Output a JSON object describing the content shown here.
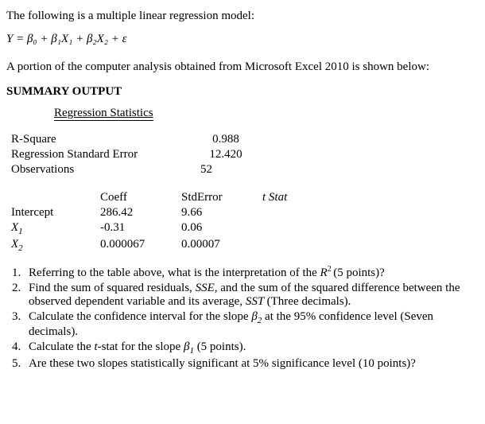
{
  "intro": "The following is a multiple linear regression model:",
  "equation": "Y = β₀ + β₁X₁ + β₂X₂ + ε",
  "context": "A portion of the computer analysis obtained from Microsoft Excel 2010 is shown below:",
  "summary_title": "SUMMARY OUTPUT",
  "reg_stats_header": "Regression Statistics",
  "stats": {
    "r_square_label": "R-Square",
    "r_square_value": "0.988",
    "rse_label": "Regression Standard Error",
    "rse_value": "12.420",
    "obs_label": "Observations",
    "obs_value": "52"
  },
  "coef_headers": {
    "coeff": "Coeff",
    "stderr": "StdError",
    "tstat": "t Stat"
  },
  "coef": {
    "intercept_label": "Intercept",
    "intercept_coeff": "286.42",
    "intercept_se": "9.66",
    "x1_label": "X",
    "x1_sub": "1",
    "x1_coeff": "-0.31",
    "x1_se": "0.06",
    "x2_label": "X",
    "x2_sub": "2",
    "x2_coeff": "0.000067",
    "x2_se": "0.00007"
  },
  "questions": {
    "q1_a": "Referring to the table above, what is the interpretation of the ",
    "q1_r": "R",
    "q1_sup": "2 ",
    "q1_b": "(5 points)?",
    "q2_a": "Find the sum of squared residuals, ",
    "q2_sse": "SSE, ",
    "q2_b": "and the sum of the squared difference between the observed dependent variable and its average, ",
    "q2_sst": "SST ",
    "q2_c": "(Three decimals).",
    "q3_a": "Calculate the confidence interval for the slope ",
    "q3_beta": "β",
    "q3_sub": "2",
    "q3_b": " at the 95% confidence level (Seven decimals).",
    "q4_a": "Calculate the ",
    "q4_t": "t",
    "q4_b": "-stat for the slope ",
    "q4_beta": "β",
    "q4_sub": "1",
    "q4_c": " (5 points).",
    "q5": "Are these two slopes statistically significant at 5% significance level (10 points)?"
  }
}
